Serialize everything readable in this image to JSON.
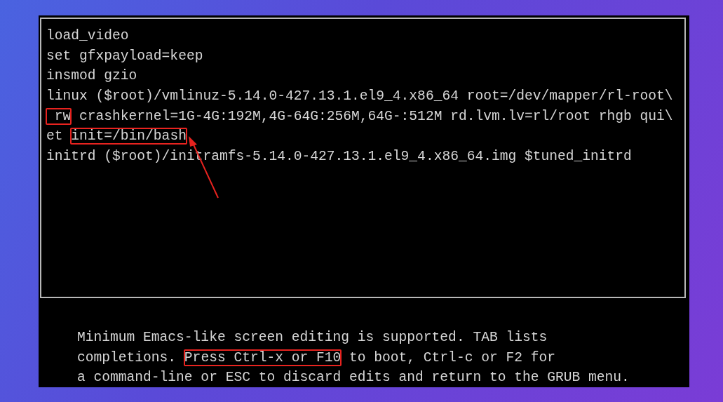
{
  "editor": {
    "lines": [
      {
        "segments": [
          {
            "text": "load_video",
            "highlighted": false
          }
        ]
      },
      {
        "segments": [
          {
            "text": "set gfxpayload=keep",
            "highlighted": false
          }
        ]
      },
      {
        "segments": [
          {
            "text": "insmod gzio",
            "highlighted": false
          }
        ]
      },
      {
        "segments": [
          {
            "text": "linux ($root)/vmlinuz-5.14.0-427.13.1.el9_4.x86_64 root=/dev/mapper/rl-root\\",
            "highlighted": false
          }
        ]
      },
      {
        "segments": [
          {
            "text": " rw",
            "highlighted": true
          },
          {
            "text": " crashkernel=1G-4G:192M,4G-64G:256M,64G-:512M rd.lvm.lv=rl/root rhgb qui\\",
            "highlighted": false
          }
        ]
      },
      {
        "segments": [
          {
            "text": "et ",
            "highlighted": false
          },
          {
            "text": "init=/bin/bash",
            "highlighted": true
          }
        ]
      },
      {
        "segments": [
          {
            "text": "initrd ($root)/initramfs-5.14.0-427.13.1.el9_4.x86_64.img $tuned_initrd",
            "highlighted": false
          }
        ]
      }
    ]
  },
  "help": {
    "lines": [
      {
        "segments": [
          {
            "text": "Minimum Emacs-like screen editing is supported. TAB lists",
            "highlighted": false
          }
        ]
      },
      {
        "segments": [
          {
            "text": "completions. ",
            "highlighted": false
          },
          {
            "text": "Press Ctrl-x or F10",
            "highlighted": true
          },
          {
            "text": " to boot, Ctrl-c or F2 for",
            "highlighted": false
          }
        ]
      },
      {
        "segments": [
          {
            "text": "a command-line or ESC to discard edits and return to the GRUB menu.",
            "highlighted": false
          }
        ]
      }
    ]
  }
}
